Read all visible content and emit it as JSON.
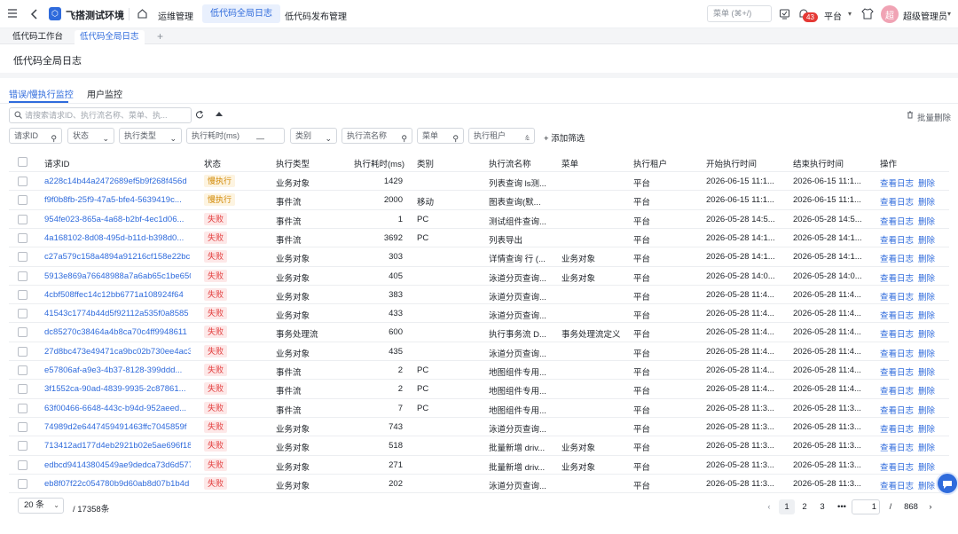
{
  "header": {
    "app_name": "飞搭测试环境",
    "logo_glyph": "⬡",
    "nav": [
      "运维管理",
      "低代码全局日志",
      "低代码发布管理"
    ],
    "search_placeholder": "菜单 (⌘+/)",
    "notif_count": "43",
    "platform": "平台",
    "avatar_text": "超",
    "user_name": "超级管理员"
  },
  "page_tabs": [
    "低代码工作台",
    "低代码全局日志"
  ],
  "page_title": "低代码全局日志",
  "sub_tabs": [
    "错误/慢执行监控",
    "用户监控"
  ],
  "toolbar": {
    "search_placeholder": "请搜索请求ID、执行流名称、菜单、执...",
    "batch_delete": "批量删除"
  },
  "filters": [
    {
      "label": "请求ID"
    },
    {
      "label": "状态"
    },
    {
      "label": "执行类型"
    },
    {
      "label": "执行耗时(ms)"
    },
    {
      "label": "类别"
    },
    {
      "label": "执行流名称"
    },
    {
      "label": "菜单"
    },
    {
      "label": "执行租户"
    }
  ],
  "add_filter": "添加筛选",
  "columns": [
    "请求ID",
    "状态",
    "执行类型",
    "执行耗时(ms)",
    "类别",
    "执行流名称",
    "菜单",
    "执行租户",
    "开始执行时间",
    "结束执行时间",
    "操作"
  ],
  "rows": [
    {
      "id": "a228c14b44a2472689ef5b9f268f456d",
      "status": "慢执行",
      "type": "业务对象",
      "cost": "1429",
      "cat": "",
      "flow": "列表查询 ls测...",
      "menu": "",
      "tenant": "平台",
      "start": "2026-06-15 11:1...",
      "end": "2026-06-15 11:1...",
      "view": "查看日志",
      "del": "删除"
    },
    {
      "id": "f9f0b8fb-25f9-47a5-bfe4-5639419c...",
      "status": "慢执行",
      "type": "事件流",
      "cost": "2000",
      "cat": "移动",
      "flow": "图表查询(默...",
      "menu": "",
      "tenant": "平台",
      "start": "2026-06-15 11:1...",
      "end": "2026-06-15 11:1...",
      "view": "查看日志",
      "del": "删除"
    },
    {
      "id": "954fe023-865a-4a68-b2bf-4ec1d06...",
      "status": "失败",
      "type": "事件流",
      "cost": "1",
      "cat": "PC",
      "flow": "测试组件查询...",
      "menu": "",
      "tenant": "平台",
      "start": "2026-05-28 14:5...",
      "end": "2026-05-28 14:5...",
      "view": "查看日志",
      "del": "删除"
    },
    {
      "id": "4a168102-8d08-495d-b11d-b398d0...",
      "status": "失败",
      "type": "事件流",
      "cost": "3692",
      "cat": "PC",
      "flow": "列表导出",
      "menu": "",
      "tenant": "平台",
      "start": "2026-05-28 14:1...",
      "end": "2026-05-28 14:1...",
      "view": "查看日志",
      "del": "删除"
    },
    {
      "id": "c27a579c158a4894a91216cf158e22bc",
      "status": "失败",
      "type": "业务对象",
      "cost": "303",
      "cat": "",
      "flow": "详情查询 行 (...",
      "menu": "业务对象",
      "tenant": "平台",
      "start": "2026-05-28 14:1...",
      "end": "2026-05-28 14:1...",
      "view": "查看日志",
      "del": "删除"
    },
    {
      "id": "5913e869a76648988a7a6ab65c1be650",
      "status": "失败",
      "type": "业务对象",
      "cost": "405",
      "cat": "",
      "flow": "泳道分页查询...",
      "menu": "业务对象",
      "tenant": "平台",
      "start": "2026-05-28 14:0...",
      "end": "2026-05-28 14:0...",
      "view": "查看日志",
      "del": "删除"
    },
    {
      "id": "4cbf508ffec14c12bb6771a108924f64",
      "status": "失败",
      "type": "业务对象",
      "cost": "383",
      "cat": "",
      "flow": "泳道分页查询...",
      "menu": "",
      "tenant": "平台",
      "start": "2026-05-28 11:4...",
      "end": "2026-05-28 11:4...",
      "view": "查看日志",
      "del": "删除"
    },
    {
      "id": "41543c1774b44d5f92112a535f0a8585",
      "status": "失败",
      "type": "业务对象",
      "cost": "433",
      "cat": "",
      "flow": "泳道分页查询...",
      "menu": "",
      "tenant": "平台",
      "start": "2026-05-28 11:4...",
      "end": "2026-05-28 11:4...",
      "view": "查看日志",
      "del": "删除"
    },
    {
      "id": "dc85270c38464a4b8ca70c4ff9948611",
      "status": "失败",
      "type": "事务处理流",
      "cost": "600",
      "cat": "",
      "flow": "执行事务流 D...",
      "menu": "事务处理流定义",
      "tenant": "平台",
      "start": "2026-05-28 11:4...",
      "end": "2026-05-28 11:4...",
      "view": "查看日志",
      "del": "删除"
    },
    {
      "id": "27d8bc473e49471ca9bc02b730ee4ac3",
      "status": "失败",
      "type": "业务对象",
      "cost": "435",
      "cat": "",
      "flow": "泳道分页查询...",
      "menu": "",
      "tenant": "平台",
      "start": "2026-05-28 11:4...",
      "end": "2026-05-28 11:4...",
      "view": "查看日志",
      "del": "删除"
    },
    {
      "id": "e57806af-a9e3-4b37-8128-399ddd...",
      "status": "失败",
      "type": "事件流",
      "cost": "2",
      "cat": "PC",
      "flow": "地图组件专用...",
      "menu": "",
      "tenant": "平台",
      "start": "2026-05-28 11:4...",
      "end": "2026-05-28 11:4...",
      "view": "查看日志",
      "del": "删除"
    },
    {
      "id": "3f1552ca-90ad-4839-9935-2c87861...",
      "status": "失败",
      "type": "事件流",
      "cost": "2",
      "cat": "PC",
      "flow": "地图组件专用...",
      "menu": "",
      "tenant": "平台",
      "start": "2026-05-28 11:4...",
      "end": "2026-05-28 11:4...",
      "view": "查看日志",
      "del": "删除"
    },
    {
      "id": "63f00466-6648-443c-b94d-952aeed...",
      "status": "失败",
      "type": "事件流",
      "cost": "7",
      "cat": "PC",
      "flow": "地图组件专用...",
      "menu": "",
      "tenant": "平台",
      "start": "2026-05-28 11:3...",
      "end": "2026-05-28 11:3...",
      "view": "查看日志",
      "del": "删除"
    },
    {
      "id": "74989d2e6447459491463ffc7045859f",
      "status": "失败",
      "type": "业务对象",
      "cost": "743",
      "cat": "",
      "flow": "泳道分页查询...",
      "menu": "",
      "tenant": "平台",
      "start": "2026-05-28 11:3...",
      "end": "2026-05-28 11:3...",
      "view": "查看日志",
      "del": "删除"
    },
    {
      "id": "713412ad177d4eb2921b02e5ae696f18",
      "status": "失败",
      "type": "业务对象",
      "cost": "518",
      "cat": "",
      "flow": "批量新增 driv...",
      "menu": "业务对象",
      "tenant": "平台",
      "start": "2026-05-28 11:3...",
      "end": "2026-05-28 11:3...",
      "view": "查看日志",
      "del": "删除"
    },
    {
      "id": "edbcd94143804549ae9dedca73d6d577",
      "status": "失败",
      "type": "业务对象",
      "cost": "271",
      "cat": "",
      "flow": "批量新增 driv...",
      "menu": "业务对象",
      "tenant": "平台",
      "start": "2026-05-28 11:3...",
      "end": "2026-05-28 11:3...",
      "view": "查看日志",
      "del": "删除"
    },
    {
      "id": "eb8f07f22c054780b9d60ab8d07b1b4d",
      "status": "失败",
      "type": "业务对象",
      "cost": "202",
      "cat": "",
      "flow": "泳道分页查询...",
      "menu": "",
      "tenant": "平台",
      "start": "2026-05-28 11:3...",
      "end": "2026-05-28 11:3...",
      "view": "查看日志",
      "del": "删除"
    }
  ],
  "pagination": {
    "page_size": "20 条",
    "total": "/ 17358条",
    "pages": [
      "1",
      "2",
      "3",
      "•••"
    ],
    "jump_value": "1",
    "slash": "/",
    "last_page": "868",
    "prev": "‹",
    "next": "›"
  },
  "colors": {
    "accent": "#2f6bdc",
    "fail": "#e23b3b",
    "slow": "#d18700"
  }
}
